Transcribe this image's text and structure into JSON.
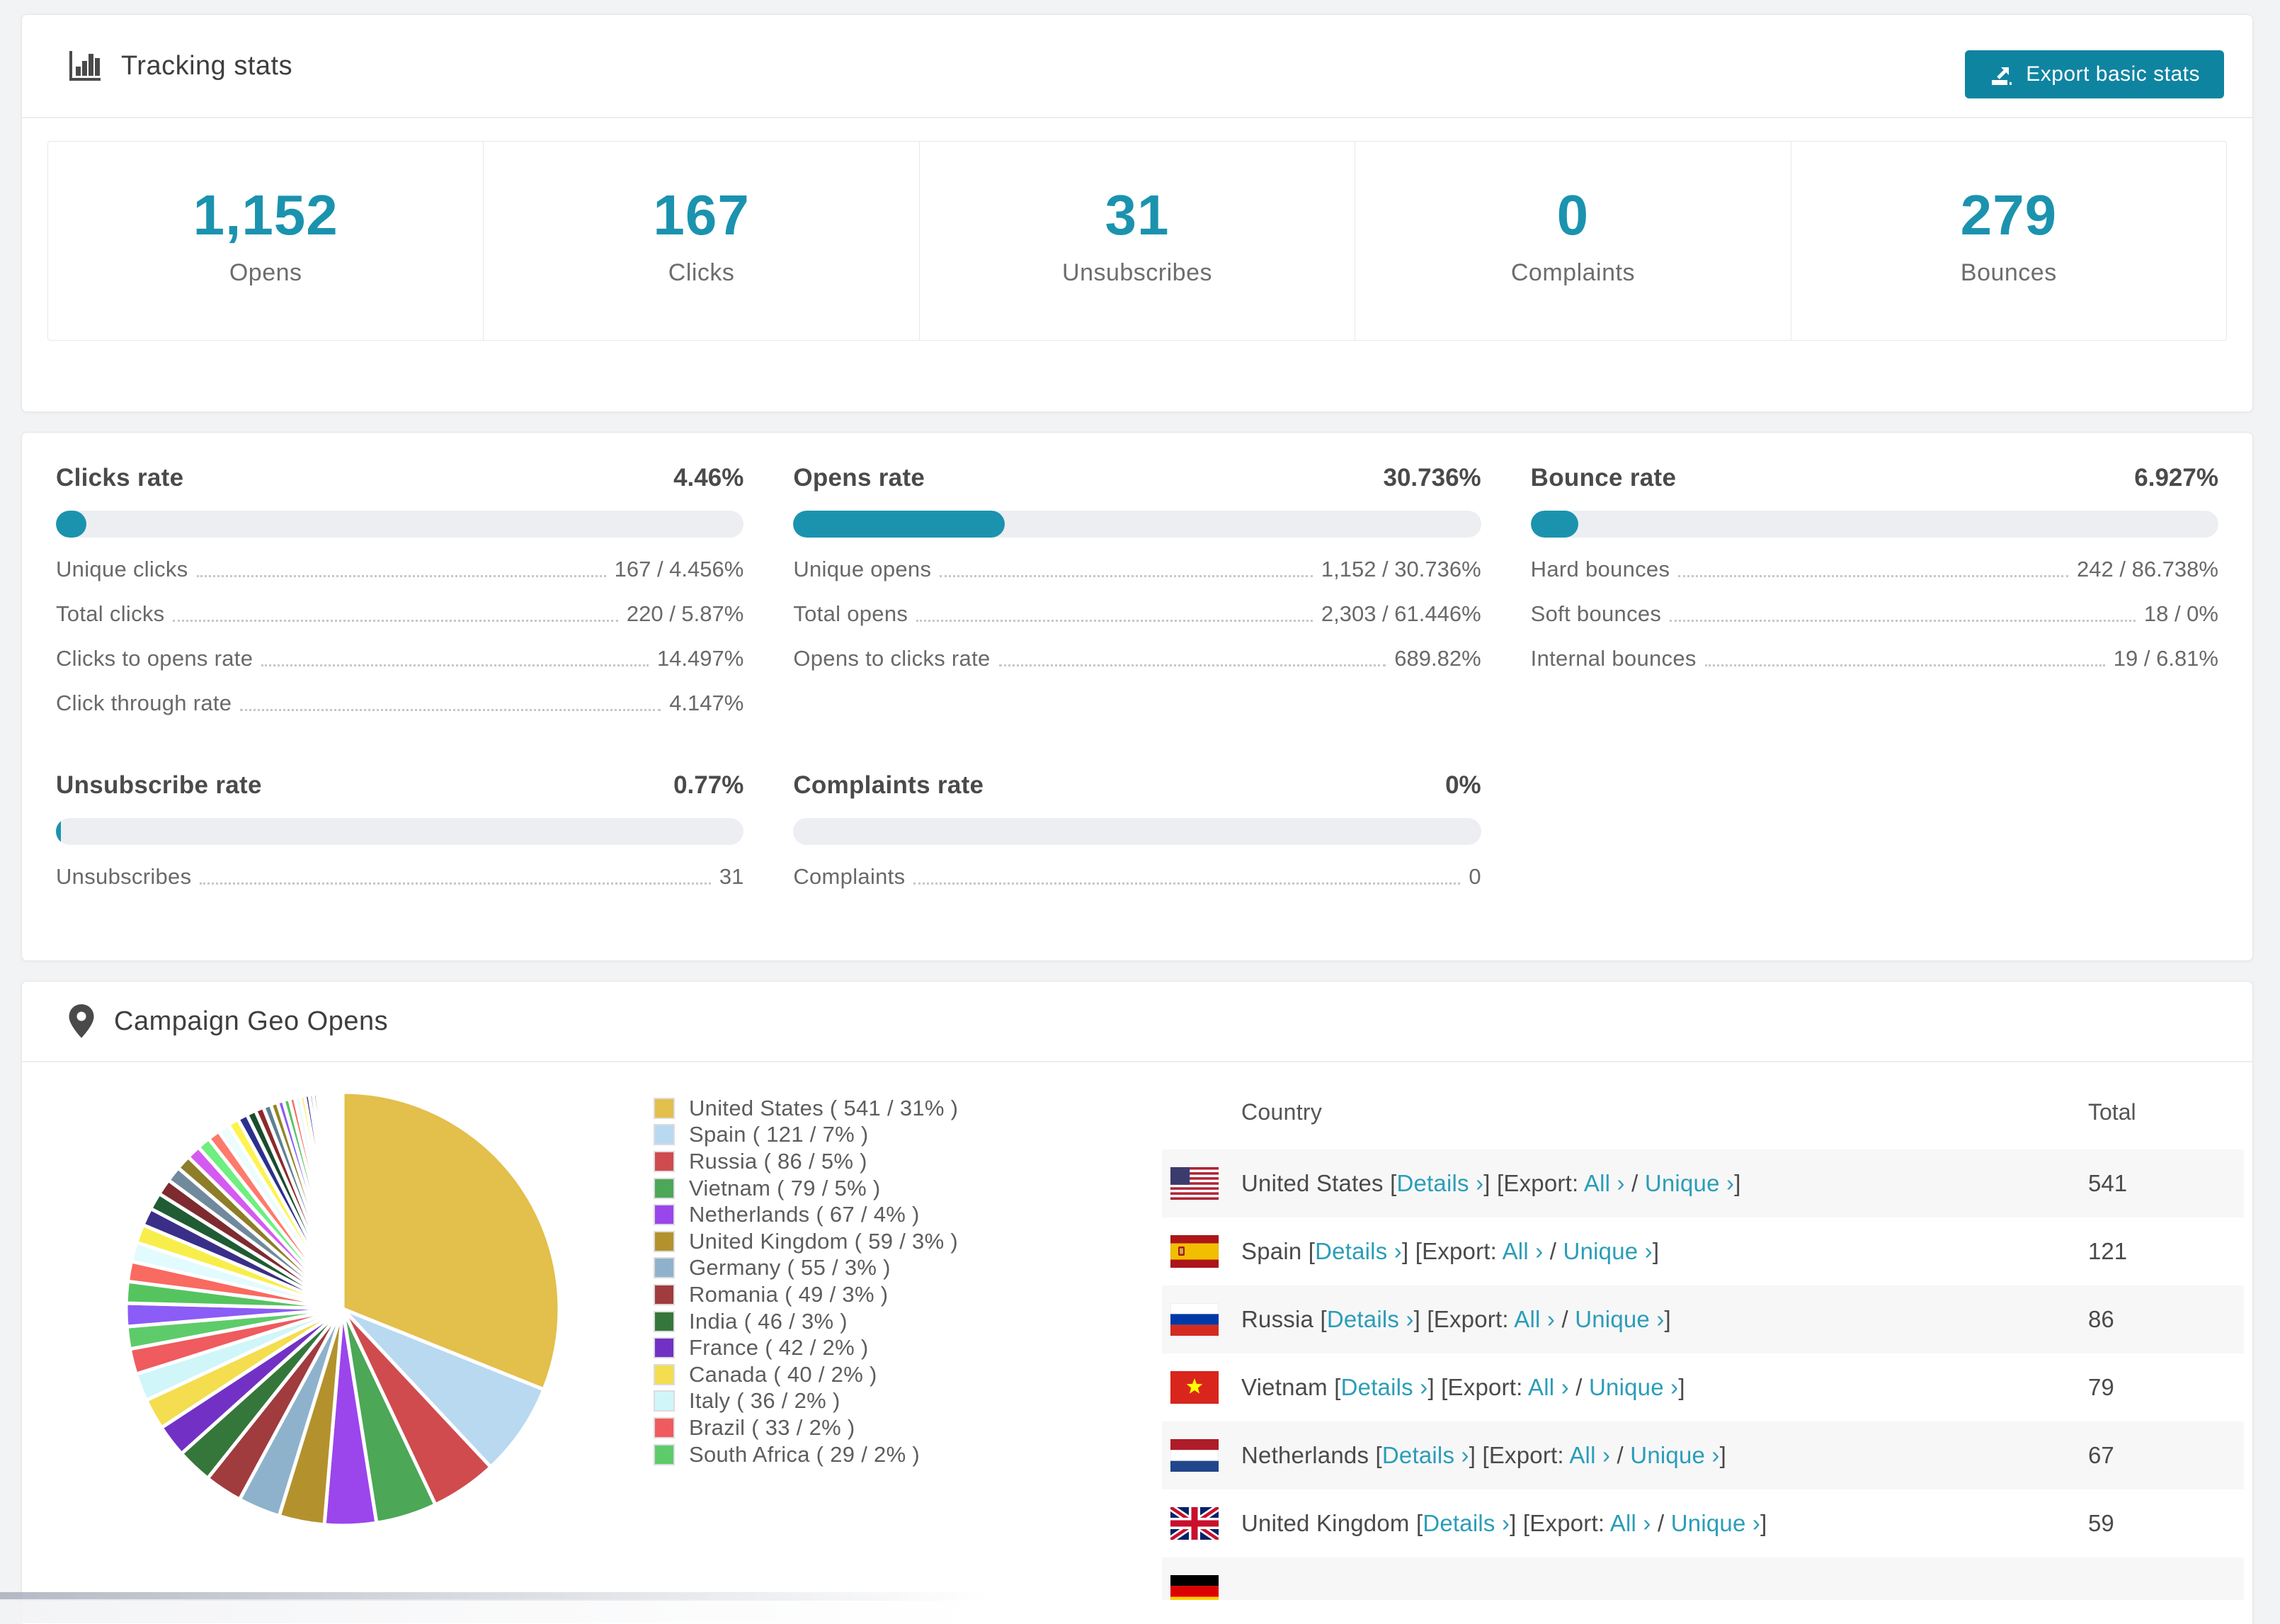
{
  "accent_color": "#1b93ae",
  "link_color": "#2b9db8",
  "header": {
    "title": "Tracking stats",
    "export_label": "Export basic stats"
  },
  "summary": [
    {
      "value": "1,152",
      "label": "Opens"
    },
    {
      "value": "167",
      "label": "Clicks"
    },
    {
      "value": "31",
      "label": "Unsubscribes"
    },
    {
      "value": "0",
      "label": "Complaints"
    },
    {
      "value": "279",
      "label": "Bounces"
    }
  ],
  "rates": [
    {
      "title": "Clicks rate",
      "value": "4.46%",
      "pct": 4.46,
      "rows": [
        [
          "Unique clicks",
          "167 / 4.456%"
        ],
        [
          "Total clicks",
          "220 / 5.87%"
        ],
        [
          "Clicks to opens rate",
          "14.497%"
        ],
        [
          "Click through rate",
          "4.147%"
        ]
      ]
    },
    {
      "title": "Opens rate",
      "value": "30.736%",
      "pct": 30.736,
      "rows": [
        [
          "Unique opens",
          "1,152 / 30.736%"
        ],
        [
          "Total opens",
          "2,303 / 61.446%"
        ],
        [
          "Opens to clicks rate",
          "689.82%"
        ]
      ]
    },
    {
      "title": "Bounce rate",
      "value": "6.927%",
      "pct": 6.927,
      "rows": [
        [
          "Hard bounces",
          "242 / 86.738%"
        ],
        [
          "Soft bounces",
          "18 / 0%"
        ],
        [
          "Internal bounces",
          "19 / 6.81%"
        ]
      ]
    },
    {
      "title": "Unsubscribe rate",
      "value": "0.77%",
      "pct": 0.77,
      "rows": [
        [
          "Unsubscribes",
          "31"
        ]
      ]
    },
    {
      "title": "Complaints rate",
      "value": "0%",
      "pct": 0,
      "rows": [
        [
          "Complaints",
          "0"
        ]
      ]
    }
  ],
  "geo": {
    "title": "Campaign Geo Opens",
    "table_headers": [
      "Country",
      "Total"
    ],
    "links": {
      "open": "[",
      "close": "]",
      "details": "Details ›",
      "export": "Export:",
      "all": "All ›",
      "slash": "/",
      "unique": "Unique ›"
    },
    "rows": [
      {
        "country": "United States",
        "total": "541",
        "flag": "us"
      },
      {
        "country": "Spain",
        "total": "121",
        "flag": "es"
      },
      {
        "country": "Russia",
        "total": "86",
        "flag": "ru"
      },
      {
        "country": "Vietnam",
        "total": "79",
        "flag": "vn"
      },
      {
        "country": "Netherlands",
        "total": "67",
        "flag": "nl"
      },
      {
        "country": "United Kingdom",
        "total": "59",
        "flag": "gb"
      },
      {
        "country": "",
        "total": "",
        "flag": "de"
      }
    ]
  },
  "chart_data": {
    "type": "pie",
    "title": "Campaign Geo Opens",
    "legend_position": "right-of-pie",
    "start_angle_deg": -90,
    "direction": "clockwise",
    "series": [
      {
        "name": "United States",
        "value": 541,
        "pct": "31%",
        "color": "#e3bf4b"
      },
      {
        "name": "Spain",
        "value": 121,
        "pct": "7%",
        "color": "#b9d9f1"
      },
      {
        "name": "Russia",
        "value": 86,
        "pct": "5%",
        "color": "#cf4b4e"
      },
      {
        "name": "Vietnam",
        "value": 79,
        "pct": "5%",
        "color": "#4ca757"
      },
      {
        "name": "Netherlands",
        "value": 67,
        "pct": "4%",
        "color": "#9b45ec"
      },
      {
        "name": "United Kingdom",
        "value": 59,
        "pct": "3%",
        "color": "#b3922e"
      },
      {
        "name": "Germany",
        "value": 55,
        "pct": "3%",
        "color": "#8fb2cc"
      },
      {
        "name": "Romania",
        "value": 49,
        "pct": "3%",
        "color": "#a03b3e"
      },
      {
        "name": "India",
        "value": 46,
        "pct": "3%",
        "color": "#35773a"
      },
      {
        "name": "France",
        "value": 42,
        "pct": "2%",
        "color": "#7231c4"
      },
      {
        "name": "Canada",
        "value": 40,
        "pct": "2%",
        "color": "#f4dd4e"
      },
      {
        "name": "Italy",
        "value": 36,
        "pct": "2%",
        "color": "#d0f6f9"
      },
      {
        "name": "Brazil",
        "value": 33,
        "pct": "2%",
        "color": "#ef5b5e"
      },
      {
        "name": "South Africa",
        "value": 29,
        "pct": "2%",
        "color": "#5ecb6a"
      }
    ],
    "other_slices": {
      "note": "unlabeled small slices, estimated",
      "values": [
        30,
        28,
        26,
        25,
        24,
        23,
        22,
        21,
        20,
        19,
        18,
        17,
        16,
        15,
        14,
        13,
        12,
        11,
        10,
        9,
        8,
        8,
        7,
        7,
        6,
        6,
        5,
        5,
        4,
        4,
        3,
        3,
        3,
        2,
        2,
        2,
        2,
        2,
        1,
        1,
        1,
        1,
        1,
        1
      ],
      "palette": [
        "#8b5cf6",
        "#55c45f",
        "#f96a60",
        "#e2fbff",
        "#f8ee4b",
        "#3a2f88",
        "#1f5c33",
        "#7d2b2f",
        "#71899d",
        "#8e7d29",
        "#d45bf1",
        "#6eef7f",
        "#fd7a6d",
        "#ecfcff",
        "#fef34e",
        "#2c308d",
        "#194d2c",
        "#8d2a2a",
        "#5d8094",
        "#948324"
      ]
    }
  }
}
